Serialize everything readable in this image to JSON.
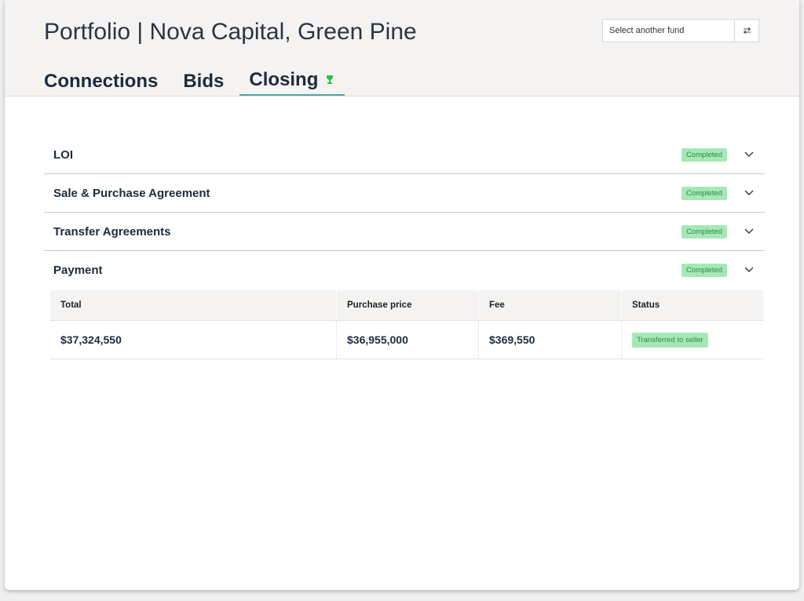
{
  "header": {
    "title": "Portfolio | Nova Capital, Green Pine",
    "fund_select_label": "Select another fund",
    "swap_icon": "swap-arrows-icon"
  },
  "tabs": [
    {
      "label": "Connections",
      "active": false
    },
    {
      "label": "Bids",
      "active": false
    },
    {
      "label": "Closing",
      "active": true,
      "icon": "trophy-icon"
    }
  ],
  "colors": {
    "accent": "#3eb0a9",
    "badge_bg": "#a5e8b6",
    "badge_text": "#2a8a48",
    "trophy": "#2bc04f",
    "heading": "#1e2b3c"
  },
  "sections": [
    {
      "title": "LOI",
      "status": "Completed"
    },
    {
      "title": "Sale & Purchase Agreement",
      "status": "Completed"
    },
    {
      "title": "Transfer Agreements",
      "status": "Completed"
    },
    {
      "title": "Payment",
      "status": "Completed"
    }
  ],
  "payment_table": {
    "columns": [
      "Total",
      "Purchase price",
      "Fee",
      "Status"
    ],
    "rows": [
      {
        "total": "$37,324,550",
        "purchase_price": "$36,955,000",
        "fee": "$369,550",
        "status": "Transferred to seller"
      }
    ]
  }
}
